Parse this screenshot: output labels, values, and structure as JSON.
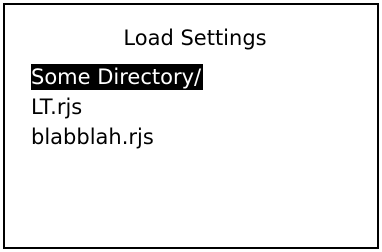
{
  "dialog": {
    "title": "Load Settings",
    "items": [
      {
        "label": "Some Directory/",
        "type": "directory",
        "selected": true
      },
      {
        "label": "LT.rjs",
        "type": "file",
        "selected": false
      },
      {
        "label": "blabblah.rjs",
        "type": "file",
        "selected": false
      }
    ]
  },
  "colors": {
    "background": "#ffffff",
    "foreground": "#000000",
    "selection_background": "#000000",
    "selection_foreground": "#ffffff"
  }
}
